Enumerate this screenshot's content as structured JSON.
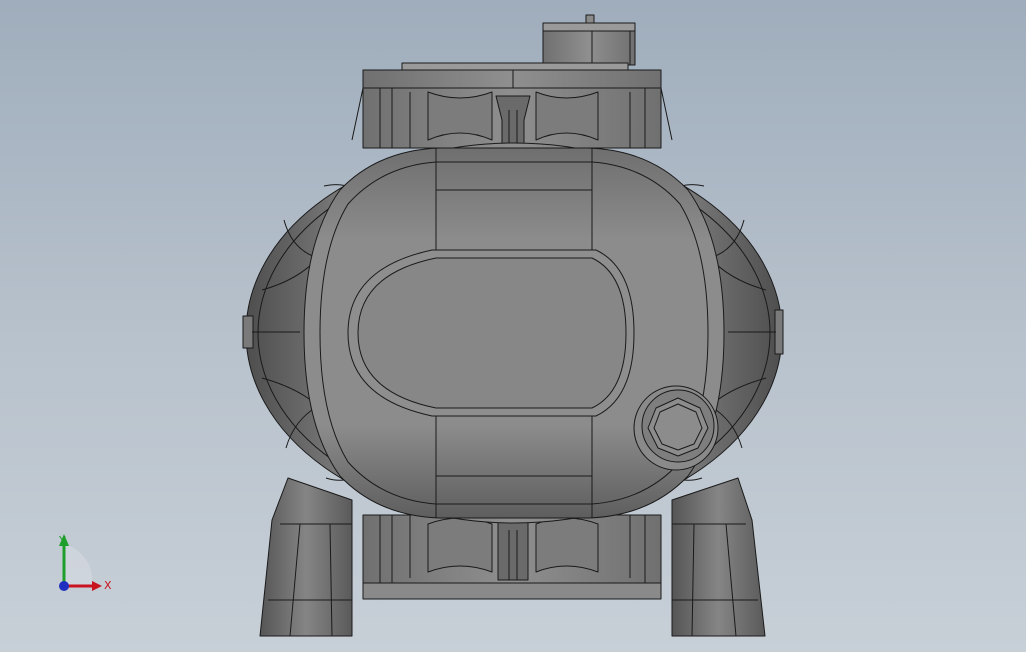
{
  "viewport": {
    "background_top": "#9fadbc",
    "background_bottom": "#c7cfd7"
  },
  "model": {
    "body_color": "#8a8a8a",
    "edge_color": "#1a1a1a",
    "shadow_color": "#4a4a4a",
    "highlight_color": "#a8a8a8"
  },
  "triad": {
    "x_label": "X",
    "y_label": "Y",
    "x_color": "#c8141e",
    "y_color": "#1e9e2a",
    "z_color": "#1f2fbf"
  }
}
